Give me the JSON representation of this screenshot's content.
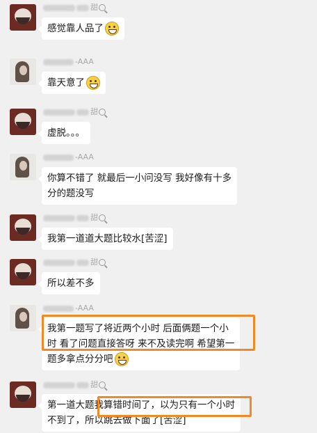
{
  "messages": [
    {
      "sender": "甜",
      "avatar": "avatar-a",
      "lines": [
        "感觉靠人品了"
      ],
      "emoji": "laughing-tears-emoji"
    },
    {
      "sender": "-AAA",
      "avatar": "avatar-b",
      "lines": [
        "靠天意了"
      ],
      "emoji": "grinning-emoji"
    },
    {
      "sender": "甜",
      "avatar": "avatar-a",
      "lines": [
        "虚脱。。。"
      ]
    },
    {
      "sender": "-AAA",
      "avatar": "avatar-b",
      "lines": [
        "你算不错了  就最后一小问没写  我好像有十多",
        "分的题没写"
      ]
    },
    {
      "sender": "甜",
      "avatar": "avatar-a",
      "lines": [
        "我第一道道大题比较水[苦涩]"
      ]
    },
    {
      "sender": "甜",
      "avatar": "avatar-a",
      "lines": [
        "所以差不多"
      ]
    },
    {
      "sender": "-AAA",
      "avatar": "avatar-b",
      "lines": [
        "我第一题写了将近两个小时  后面俩题一个小",
        "时  看了问题直接答呀   来不及读完啊   希望第一",
        "题多拿点分分吧"
      ],
      "emoji": "grinning-emoji"
    },
    {
      "sender": "甜",
      "avatar": "avatar-a",
      "lines": [
        "第一道大题我算错时间了，以为只有一个小时",
        "不到了，所以跳去做下面了[苦涩]"
      ]
    }
  ]
}
